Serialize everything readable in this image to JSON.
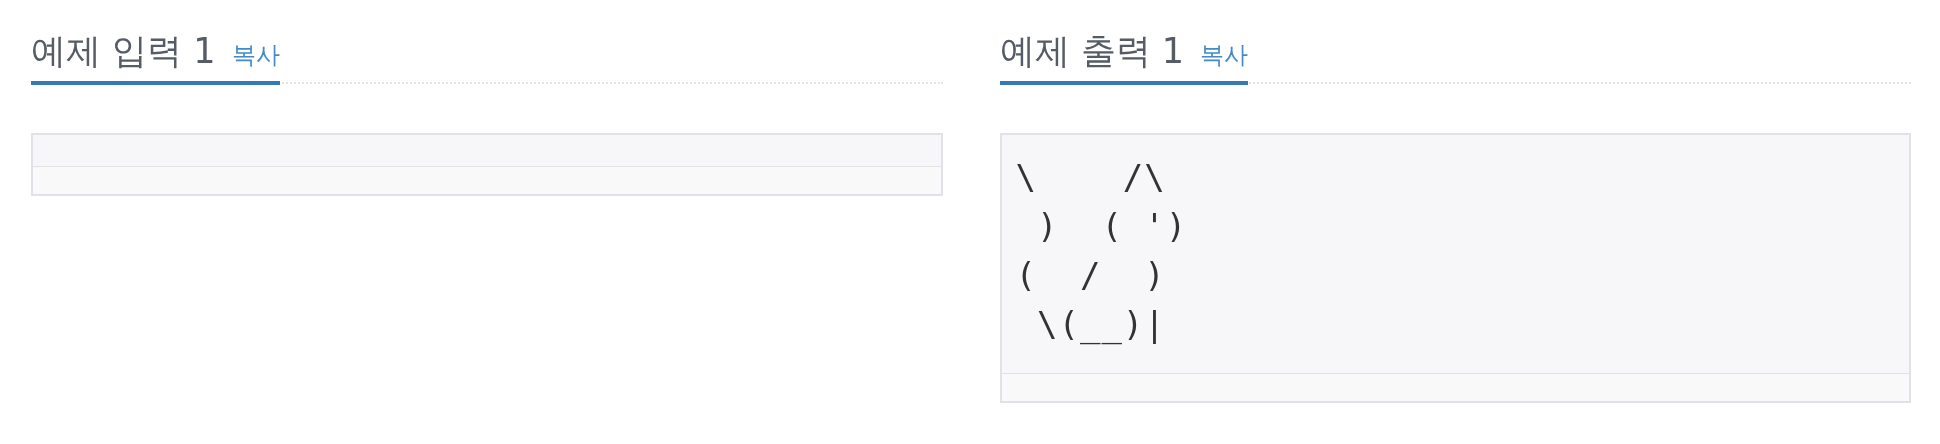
{
  "samples": [
    {
      "title": "예제 입력 1",
      "copy": "복사"
    },
    {
      "title": "예제 출력 1",
      "copy": "복사",
      "lines": [
        "\\    /\\",
        " )  ( ')",
        "(  /  )",
        " \\(__)|"
      ]
    }
  ]
}
